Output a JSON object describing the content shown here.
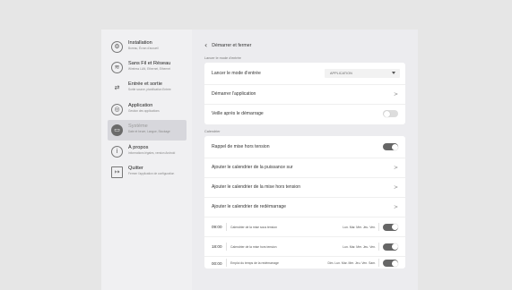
{
  "sidebar": {
    "items": [
      {
        "title": "Installation",
        "subtitle": "Bureau, Écran d'accueil",
        "icon": "gear-icon",
        "glyph": "⚙"
      },
      {
        "title": "Sans Fil et Réseau",
        "subtitle": "Wireless LAN, Ethernet, Ethernet",
        "icon": "wifi-icon",
        "glyph": "≋"
      },
      {
        "title": "Entrée et sortie",
        "subtitle": "Sortie source, planification Entrée",
        "icon": "input-output-icon",
        "glyph": "⇄"
      },
      {
        "title": "Application",
        "subtitle": "Gestion des applications",
        "icon": "application-icon",
        "glyph": "◎"
      },
      {
        "title": "Système",
        "subtitle": "Date et heure, Langue, Stockage",
        "icon": "system-icon",
        "glyph": "▭"
      },
      {
        "title": "À propos",
        "subtitle": "Informations légales, version Android",
        "icon": "info-icon",
        "glyph": "i"
      },
      {
        "title": "Quitter",
        "subtitle": "Fermer l'application de configuration",
        "icon": "exit-icon",
        "glyph": "↦"
      }
    ]
  },
  "panel": {
    "back_glyph": "‹",
    "title": "Démarrer et fermer",
    "section_launch": "Lancer le mode d'entrée",
    "launch_mode_label": "Lancer le mode d'entrée",
    "launch_mode_value": "APPLICATION",
    "start_app_label": "Démarrer l'application",
    "standby_label": "Veille après le démarrage",
    "standby_on": false,
    "section_calendar": "Calendrier",
    "recall_label": "Rappel de mise hors tension",
    "recall_on": true,
    "add_power_on_label": "Ajouter le calendrier de la puissance sur",
    "add_power_off_label": "Ajouter le calendrier de la mise hors tension",
    "add_restart_label": "Ajouter le calendrier de redémarrage",
    "chevron_glyph": ">",
    "schedules": [
      {
        "time": "09:00",
        "desc": "Calendrier de la mise sous tension",
        "days": "Lun. Mar. Mer. Jeu. Ven.",
        "on": true
      },
      {
        "time": "18:00",
        "desc": "Calendrier de la mise hors tension",
        "days": "Lun. Mar. Mer. Jeu. Ven.",
        "on": true
      },
      {
        "time": "00:00",
        "desc": "Emploi du temps de la redémarrage",
        "days": "Dim. Lun. Mar. Mer. Jeu. Ven. Sam.",
        "on": true
      }
    ]
  }
}
